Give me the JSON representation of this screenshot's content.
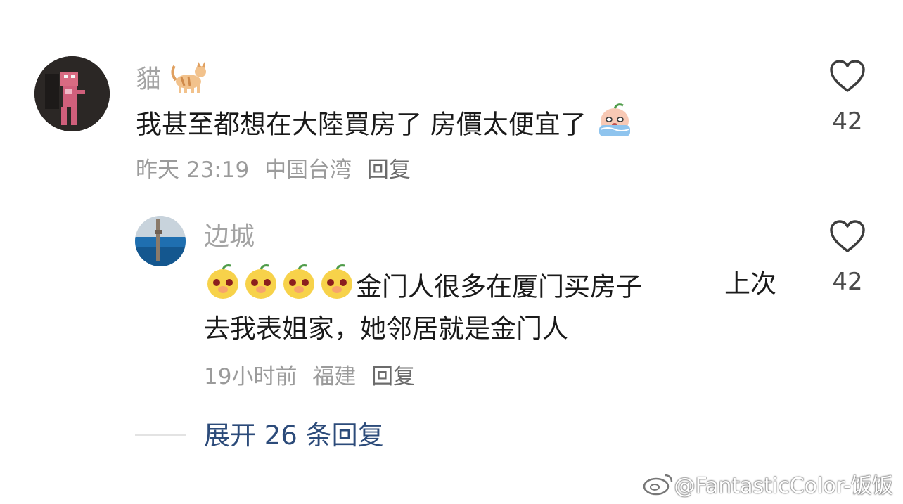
{
  "comments": [
    {
      "username": "貓",
      "text_parts": [
        "我甚至都想在大陸買房了 房價太便宜了"
      ],
      "time": "昨天 23:19",
      "location": "中国台湾",
      "reply_label": "回复",
      "likes": "42",
      "icons": {
        "name_emoji": "cat-emoji-icon",
        "text_emoji": "crying-emoji-icon"
      }
    },
    {
      "username": "边城",
      "text_line1": "金门人很多在厦门买房子",
      "text_line1_tail": "上次",
      "text_line2": "去我表姐家，她邻居就是金门人",
      "time": "19小时前",
      "location": "福建",
      "reply_label": "回复",
      "likes": "42",
      "icons": {
        "text_emoji": "mango-emoji-icon",
        "count": 4
      }
    }
  ],
  "expand_replies": "展开 26 条回复",
  "watermark": "@FantasticColor-饭饭",
  "colors": {
    "username": "#a3a3a3",
    "text": "#1a1a1a",
    "meta": "#9b9b9b",
    "expand": "#2c4b7a"
  }
}
